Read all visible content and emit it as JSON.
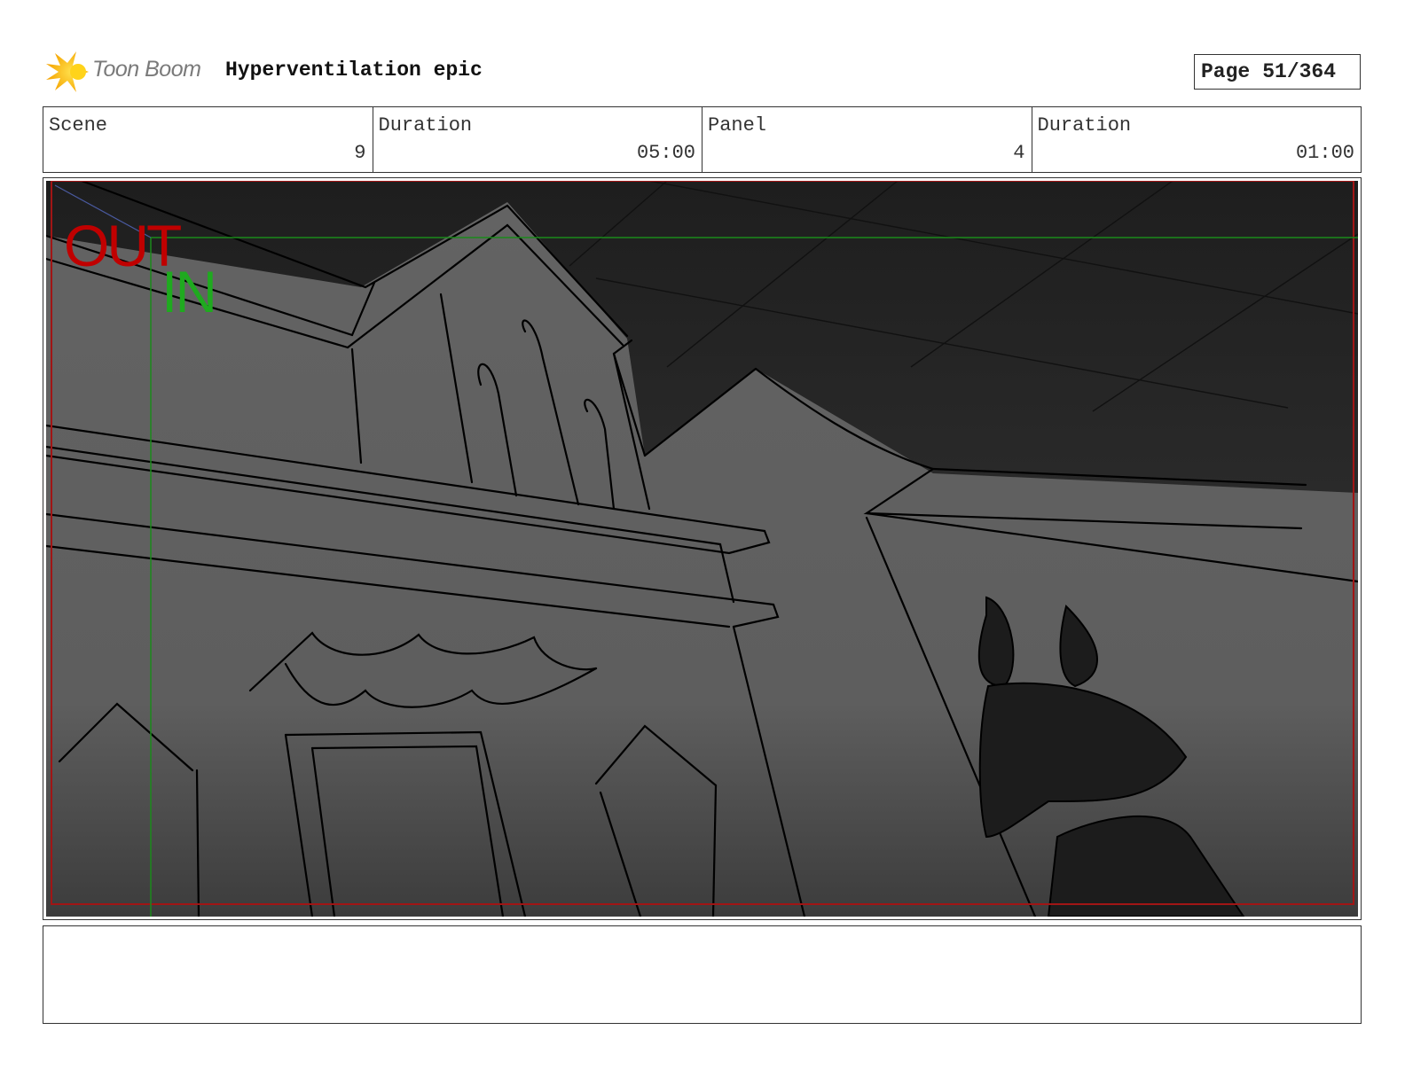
{
  "header": {
    "logo_text": "Toon Boom",
    "project_title": "Hyperventilation epic",
    "page_label": "Page",
    "page_number": "51/364"
  },
  "info": {
    "scene_label": "Scene",
    "scene_value": "9",
    "scene_duration_label": "Duration",
    "scene_duration_value": "05:00",
    "panel_label": "Panel",
    "panel_value": "4",
    "panel_duration_label": "Duration",
    "panel_duration_value": "01:00"
  },
  "panel": {
    "out_label": "OUT",
    "in_label": "IN",
    "colors": {
      "out": "#c00000",
      "in": "#1faa1f",
      "sky": "#2a2a2a",
      "wall": "#5f5f5f"
    }
  },
  "caption": {
    "text": ""
  }
}
